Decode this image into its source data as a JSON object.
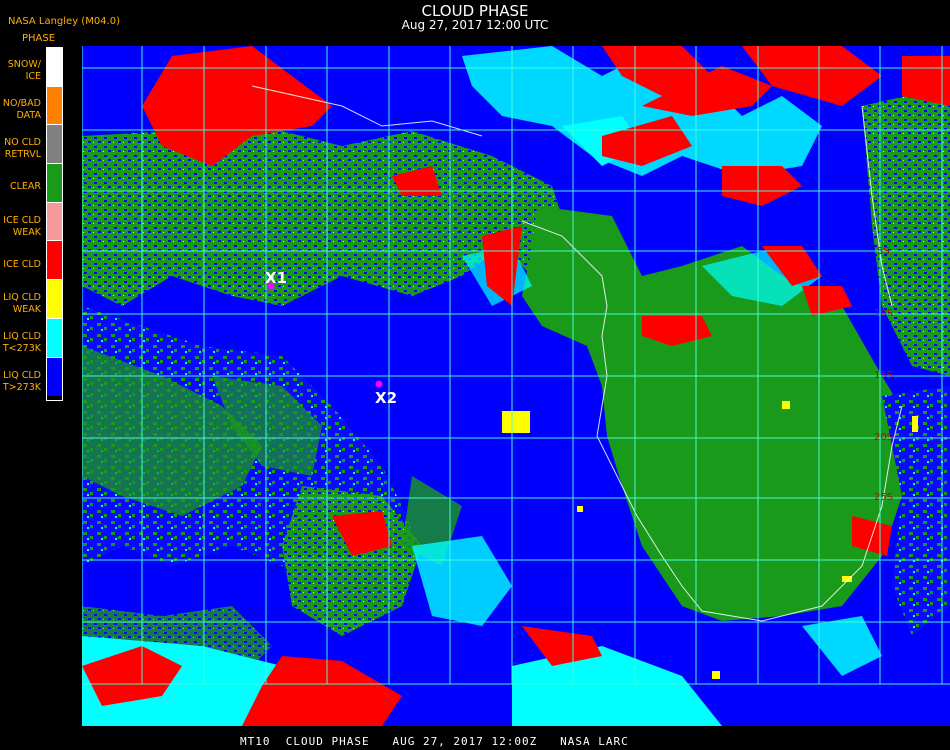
{
  "header": {
    "title": "CLOUD PHASE",
    "datetime": "Aug 27, 2017 12:00 UTC",
    "organization": "NASA Langley (M04.0)",
    "legend_title": "PHASE"
  },
  "legend": [
    {
      "label": "SNOW/\nICE",
      "color": "#ffffff"
    },
    {
      "label": "NO/BAD\nDATA",
      "color": "#ff7f00"
    },
    {
      "label": "NO CLD\nRETRVL",
      "color": "#808080"
    },
    {
      "label": "CLEAR",
      "color": "#1a9a1a"
    },
    {
      "label": "ICE CLD\nWEAK",
      "color": "#f59a9a"
    },
    {
      "label": "ICE CLD",
      "color": "#ff0000"
    },
    {
      "label": "LIQ CLD\nWEAK",
      "color": "#ffff00"
    },
    {
      "label": "LIQ CLD\nT<273K",
      "color": "#00ffff"
    },
    {
      "label": "LIQ CLD\nT>273K",
      "color": "#0000ff"
    }
  ],
  "markers": [
    {
      "label": "X1"
    },
    {
      "label": "X2"
    }
  ],
  "lat_labels": [
    "5S",
    "10S",
    "15S",
    "20S",
    "25S"
  ],
  "footer": "MT10  CLOUD PHASE   AUG 27, 2017 12:00Z   NASA LARC"
}
